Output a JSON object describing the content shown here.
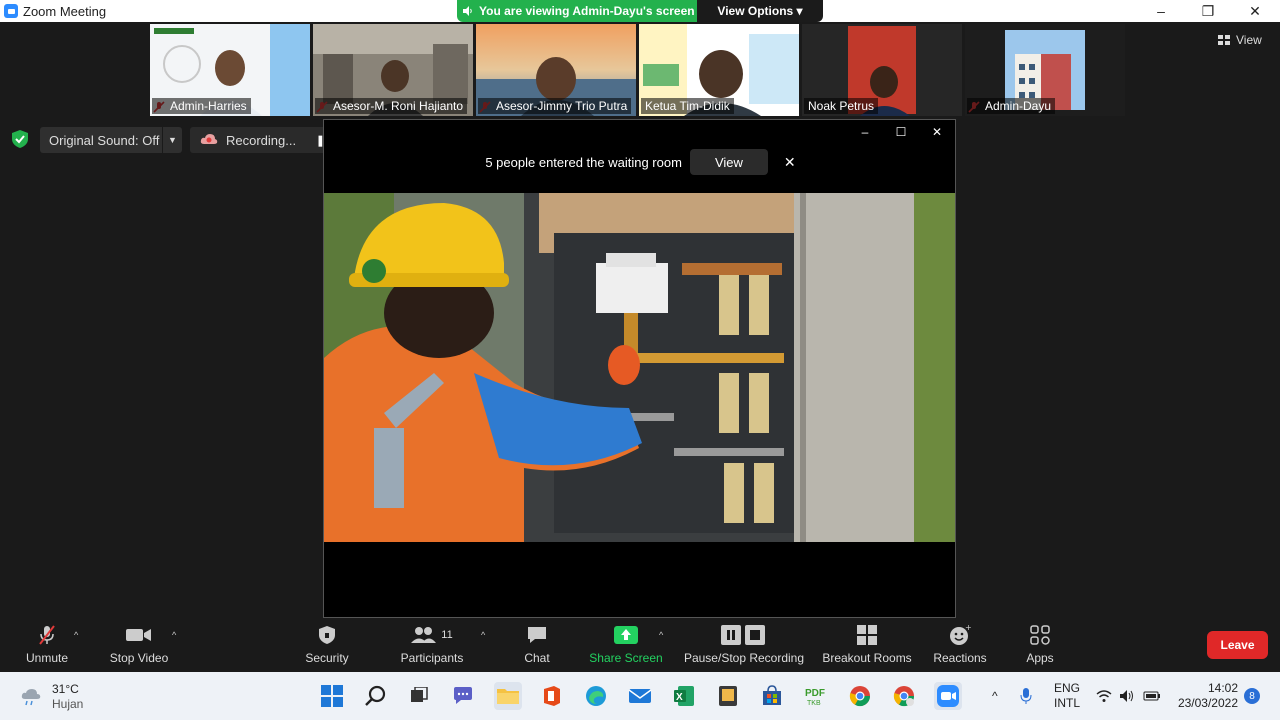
{
  "window": {
    "title": "Zoom Meeting",
    "minimize": "–",
    "restore": "❐",
    "close": "✕"
  },
  "share_banner": {
    "text": "You are viewing Admin-Dayu's screen",
    "view_options": "View Options ▾"
  },
  "gallery": {
    "view_label": "View",
    "participants": [
      {
        "name": "Admin-Harries",
        "muted": true
      },
      {
        "name": "Asesor-M. Roni Hajianto",
        "muted": true
      },
      {
        "name": "Asesor-Jimmy Trio Putra",
        "muted": true
      },
      {
        "name": "Ketua Tim-Didik",
        "muted": false
      },
      {
        "name": "Noak Petrus",
        "muted": false,
        "active": true
      },
      {
        "name": "Admin-Dayu",
        "muted": true
      }
    ]
  },
  "audio": {
    "original_sound": "Original Sound: Off",
    "recording": "Recording..."
  },
  "shared_window": {
    "waiting_text": "5 people entered the waiting room",
    "view_button": "View",
    "close": "✕"
  },
  "controls": {
    "unmute": "Unmute",
    "stop_video": "Stop Video",
    "security": "Security",
    "participants": "Participants",
    "participants_count": "11",
    "chat": "Chat",
    "share_screen": "Share Screen",
    "pause_stop_recording": "Pause/Stop Recording",
    "breakout_rooms": "Breakout Rooms",
    "reactions": "Reactions",
    "apps": "Apps",
    "leave": "Leave"
  },
  "taskbar": {
    "temperature": "31°C",
    "weather": "Hujan",
    "language_top": "ENG",
    "language_bottom": "INTL",
    "time": "14:02",
    "date": "23/03/2022",
    "notifications": "8"
  },
  "colors": {
    "accent_green": "#23b14d",
    "leave_red": "#e02828",
    "share_green": "#23d160",
    "zoom_blue": "#2d8cff"
  }
}
